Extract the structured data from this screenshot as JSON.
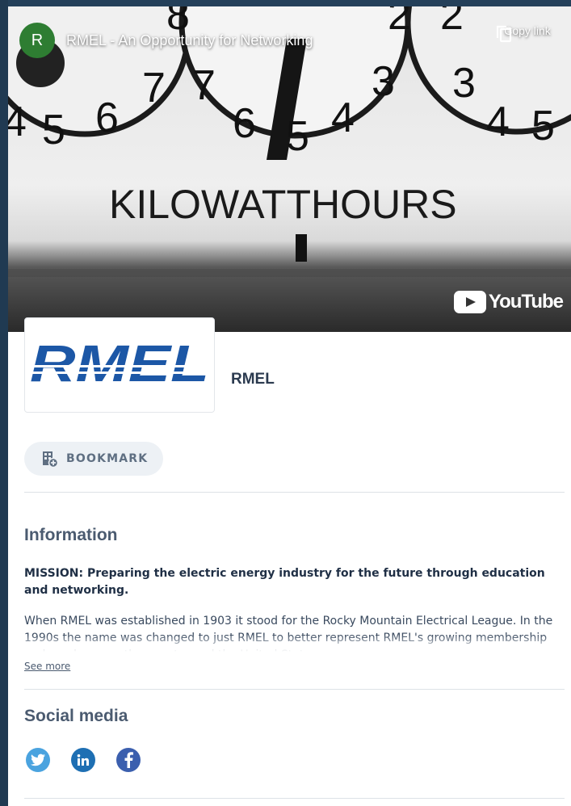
{
  "video": {
    "channel_initial": "R",
    "title": "RMEL - An Opportunity for Networking",
    "copy_link_label": "Copy link",
    "youtube_word": "YouTube",
    "frame": {
      "meter_label": "KILOWATTHOURS",
      "dial_digits": [
        "4",
        "5",
        "6",
        "7",
        "8",
        "7",
        "6",
        "5",
        "4",
        "3",
        "2",
        "2",
        "3",
        "4",
        "5"
      ]
    }
  },
  "company": {
    "logo_text": "RMEL",
    "name": "RMEL"
  },
  "bookmark": {
    "label": "BOOKMARK"
  },
  "information": {
    "title": "Information",
    "mission": "MISSION: Preparing the electric energy industry for the future through education and networking.",
    "description": "When RMEL was established in 1903 it stood for the Rocky Mountain Electrical League. In the 1990s the name was changed to just RMEL to better represent RMEL's growing membership and reach across the country and the United States.",
    "see_more": "See more"
  },
  "social": {
    "title": "Social media",
    "links": [
      {
        "name": "twitter",
        "color": "#4aa3df"
      },
      {
        "name": "linkedin",
        "color": "#1e6fb3"
      },
      {
        "name": "facebook",
        "color": "#3b5fae"
      }
    ]
  },
  "colors": {
    "accent_blue": "#1c57a6",
    "text_dark": "#2b3a4f",
    "background": "#1d3447"
  }
}
